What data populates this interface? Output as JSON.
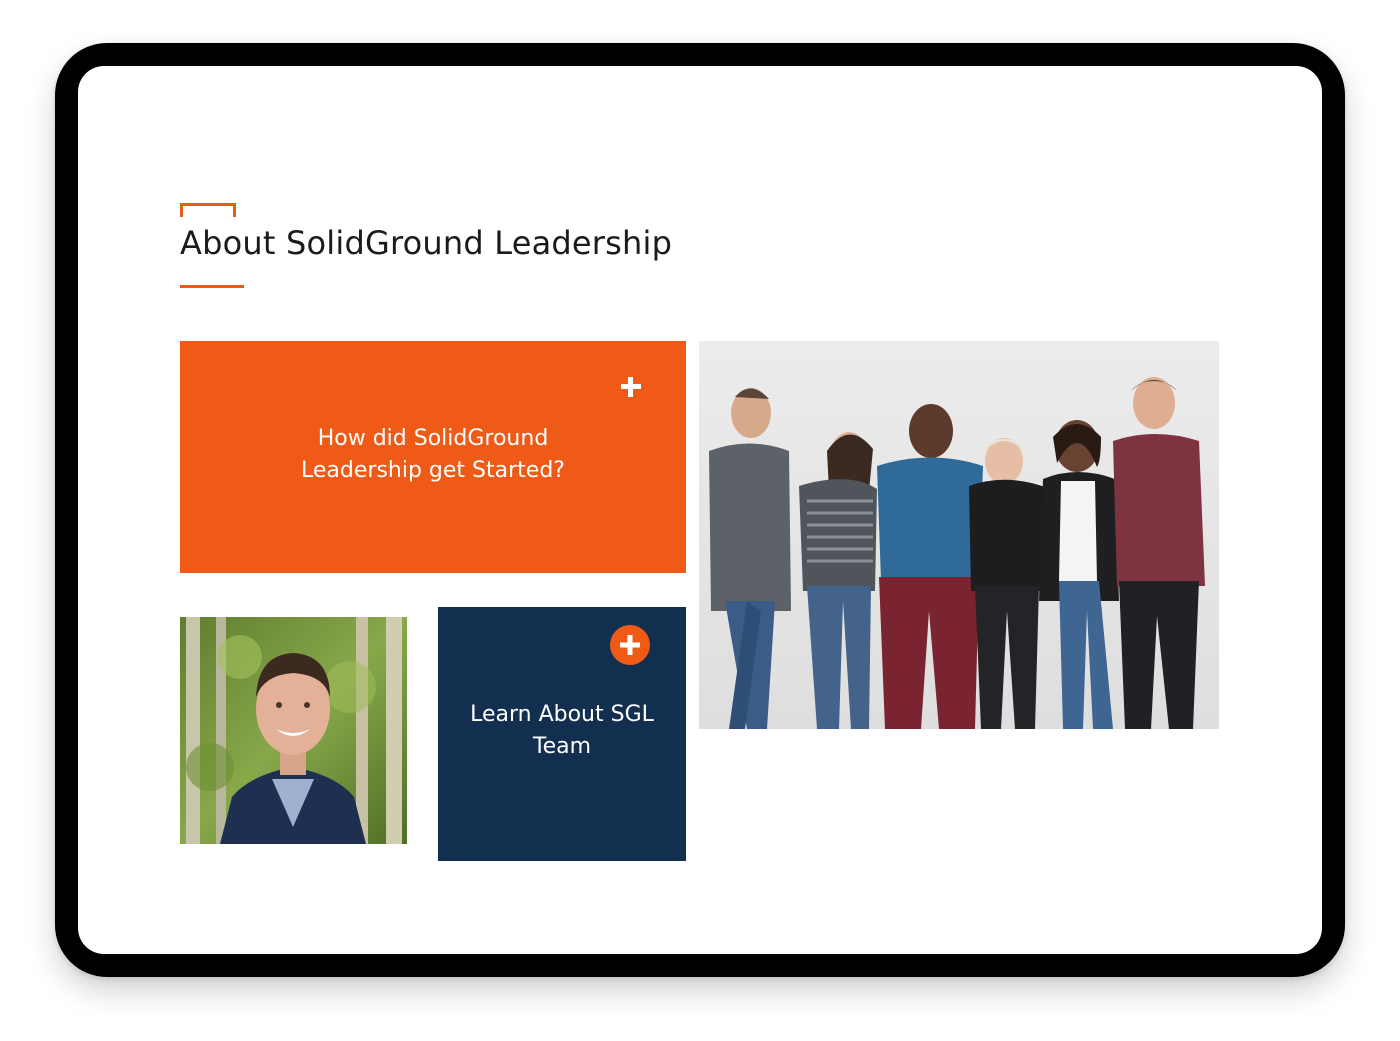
{
  "section": {
    "title": "About SolidGround Leadership"
  },
  "cards": {
    "started": {
      "label": "How did SolidGround Leadership get Started?",
      "icon": "plus-icon"
    },
    "team": {
      "label": "Learn About SGL Team",
      "icon": "plus-circle-icon"
    }
  },
  "colors": {
    "accent": "#ef5a16",
    "navy": "#132f50",
    "frame": "#000000"
  }
}
